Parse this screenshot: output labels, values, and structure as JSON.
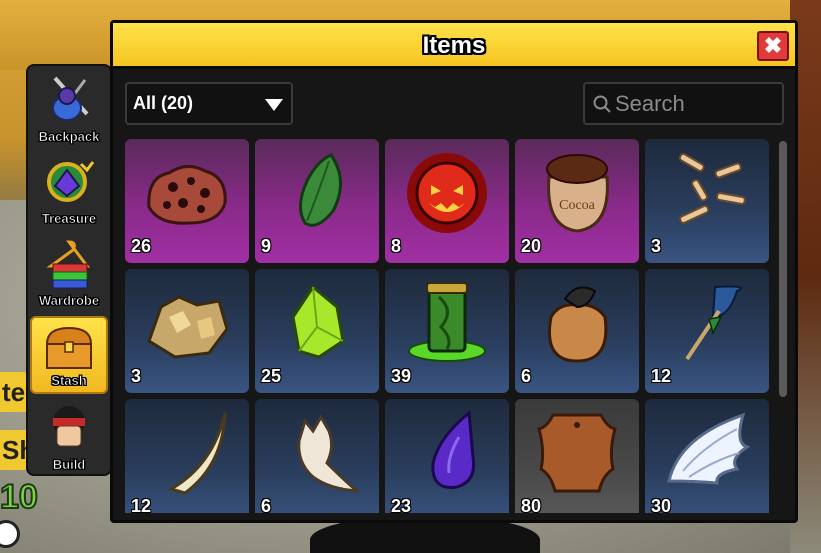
{
  "window": {
    "title": "Items",
    "close_label": "✖"
  },
  "filter": {
    "selected": "All (20)"
  },
  "search": {
    "placeholder": "Search",
    "value": ""
  },
  "sidebar": {
    "items": [
      {
        "label": "Backpack",
        "icon": "backpack-icon",
        "active": false
      },
      {
        "label": "Treasure",
        "icon": "treasure-icon",
        "active": false
      },
      {
        "label": "Wardrobe",
        "icon": "wardrobe-icon",
        "active": false
      },
      {
        "label": "Stash",
        "icon": "stash-chest-icon",
        "active": true
      },
      {
        "label": "Build",
        "icon": "build-avatar-icon",
        "active": false
      }
    ]
  },
  "background": {
    "left_label_1": "te",
    "left_label_2": "Sh",
    "green_number": "10"
  },
  "items": [
    {
      "name": "lava-rock",
      "qty": "26",
      "rarity": "purple"
    },
    {
      "name": "leaf",
      "qty": "9",
      "rarity": "purple"
    },
    {
      "name": "pumpkin-face",
      "qty": "8",
      "rarity": "purple"
    },
    {
      "name": "cocoa-sack",
      "qty": "20",
      "rarity": "purple"
    },
    {
      "name": "bones",
      "qty": "3",
      "rarity": "blue"
    },
    {
      "name": "gold-ore",
      "qty": "3",
      "rarity": "blue"
    },
    {
      "name": "green-crystal",
      "qty": "25",
      "rarity": "blue"
    },
    {
      "name": "slime-jar",
      "qty": "39",
      "rarity": "blue"
    },
    {
      "name": "cloth-sack",
      "qty": "6",
      "rarity": "blue"
    },
    {
      "name": "feather-arrow",
      "qty": "12",
      "rarity": "blue"
    },
    {
      "name": "fang",
      "qty": "12",
      "rarity": "blue"
    },
    {
      "name": "claw",
      "qty": "6",
      "rarity": "blue"
    },
    {
      "name": "dark-drop",
      "qty": "23",
      "rarity": "blue"
    },
    {
      "name": "leather",
      "qty": "80",
      "rarity": "gray"
    },
    {
      "name": "angel-wing",
      "qty": "30",
      "rarity": "blue"
    }
  ],
  "colors": {
    "title_bar": "#f5c522",
    "close": "#e23a3a",
    "active_nav": "#f0b820"
  }
}
